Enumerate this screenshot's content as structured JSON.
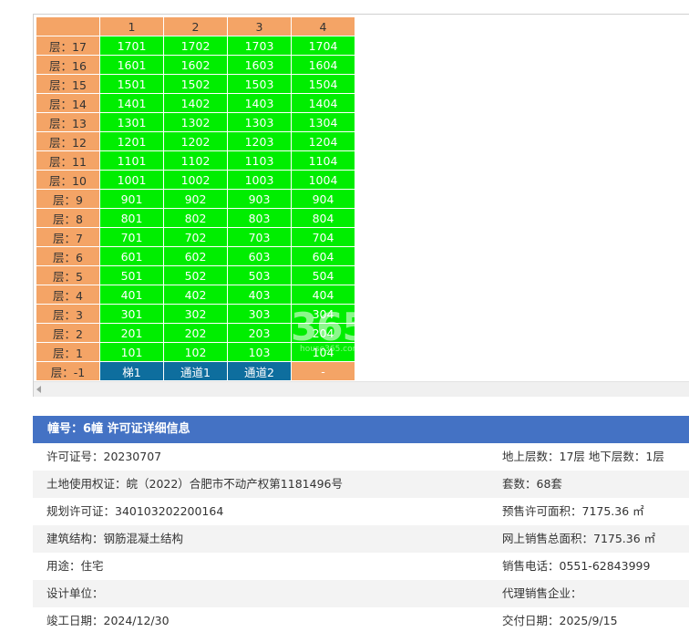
{
  "grid": {
    "columns": [
      "",
      "1",
      "2",
      "3",
      "4"
    ],
    "rows": [
      {
        "floor": "层：17",
        "units": [
          "1701",
          "1702",
          "1703",
          "1704"
        ]
      },
      {
        "floor": "层：16",
        "units": [
          "1601",
          "1602",
          "1603",
          "1604"
        ]
      },
      {
        "floor": "层：15",
        "units": [
          "1501",
          "1502",
          "1503",
          "1504"
        ]
      },
      {
        "floor": "层：14",
        "units": [
          "1401",
          "1402",
          "1403",
          "1404"
        ]
      },
      {
        "floor": "层：13",
        "units": [
          "1301",
          "1302",
          "1303",
          "1304"
        ]
      },
      {
        "floor": "层：12",
        "units": [
          "1201",
          "1202",
          "1203",
          "1204"
        ]
      },
      {
        "floor": "层：11",
        "units": [
          "1101",
          "1102",
          "1103",
          "1104"
        ]
      },
      {
        "floor": "层：10",
        "units": [
          "1001",
          "1002",
          "1003",
          "1004"
        ]
      },
      {
        "floor": "层：9",
        "units": [
          "901",
          "902",
          "903",
          "904"
        ]
      },
      {
        "floor": "层：8",
        "units": [
          "801",
          "802",
          "803",
          "804"
        ]
      },
      {
        "floor": "层：7",
        "units": [
          "701",
          "702",
          "703",
          "704"
        ]
      },
      {
        "floor": "层：6",
        "units": [
          "601",
          "602",
          "603",
          "604"
        ]
      },
      {
        "floor": "层：5",
        "units": [
          "501",
          "502",
          "503",
          "504"
        ]
      },
      {
        "floor": "层：4",
        "units": [
          "401",
          "402",
          "403",
          "404"
        ]
      },
      {
        "floor": "层：3",
        "units": [
          "301",
          "302",
          "303",
          "304"
        ]
      },
      {
        "floor": "层：2",
        "units": [
          "201",
          "202",
          "203",
          "204"
        ]
      },
      {
        "floor": "层：1",
        "units": [
          "101",
          "102",
          "103",
          "104"
        ]
      }
    ],
    "basement": {
      "floor": "层：-1",
      "units": [
        "梯1",
        "通道1",
        "通道2",
        "-"
      ]
    },
    "colors": {
      "header": "#f4a466",
      "unit_available": "#00ee00",
      "special": "#0e6e9e",
      "empty": "#f4a466"
    }
  },
  "watermark": {
    "logo": "365",
    "small": "house365.com"
  },
  "permit": {
    "title": "幢号：6幢 许可证详细信息",
    "rows": [
      {
        "left": "许可证号：20230707",
        "right": "地上层数：17层  地下层数：1层"
      },
      {
        "left": "土地使用权证：皖（2022）合肥市不动产权第1181496号",
        "right": "套数：68套"
      },
      {
        "left": "规划许可证：340103202200164",
        "right": "预售许可面积：7175.36 ㎡"
      },
      {
        "left": "建筑结构：钢筋混凝土结构",
        "right": "网上销售总面积：7175.36 ㎡"
      },
      {
        "left": "用途：住宅",
        "right": "销售电话：0551-62843999"
      },
      {
        "left": "设计单位：",
        "right": "代理销售企业："
      },
      {
        "left": "竣工日期：2024/12/30",
        "right": "交付日期：2025/9/15"
      }
    ]
  }
}
